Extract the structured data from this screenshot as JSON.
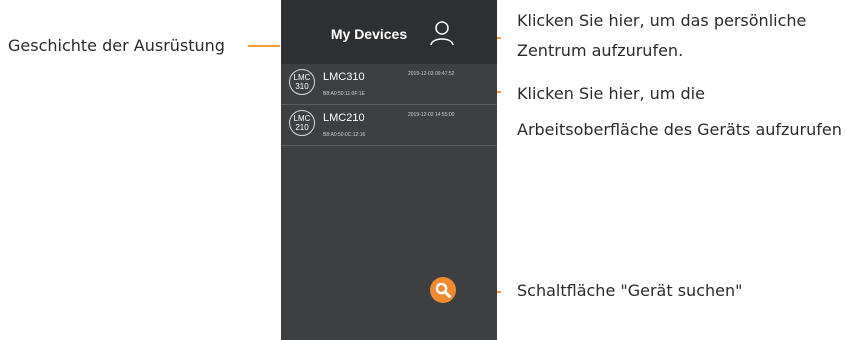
{
  "annotations": {
    "history": "Geschichte der Ausrüstung",
    "personal_line1": "Klicken Sie hier, um das persönliche",
    "personal_line2": "Zentrum aufzurufen.",
    "workspace_line1": "Klicken Sie hier, um die",
    "workspace_line2": "Arbeitsoberfläche des Geräts aufzurufen",
    "search": "Schaltfläche \"Gerät suchen\""
  },
  "app": {
    "title": "My Devices",
    "devices": [
      {
        "badge_top": "LMC",
        "badge_bottom": "310",
        "name": "LMC310",
        "mac": "B8:A0:50:11:0F:1E",
        "time": "2019-12-03 09:47:52"
      },
      {
        "badge_top": "LMC",
        "badge_bottom": "210",
        "name": "LMC210",
        "mac": "B8:A0:50:0C:12:16",
        "time": "2019-12-02 14:55:00"
      }
    ]
  },
  "icons": {
    "profile": "user-icon",
    "search": "search-icon"
  },
  "colors": {
    "accent": "#f0892f",
    "header_bg": "#2e2f31",
    "screen_bg": "#3e3f41"
  }
}
